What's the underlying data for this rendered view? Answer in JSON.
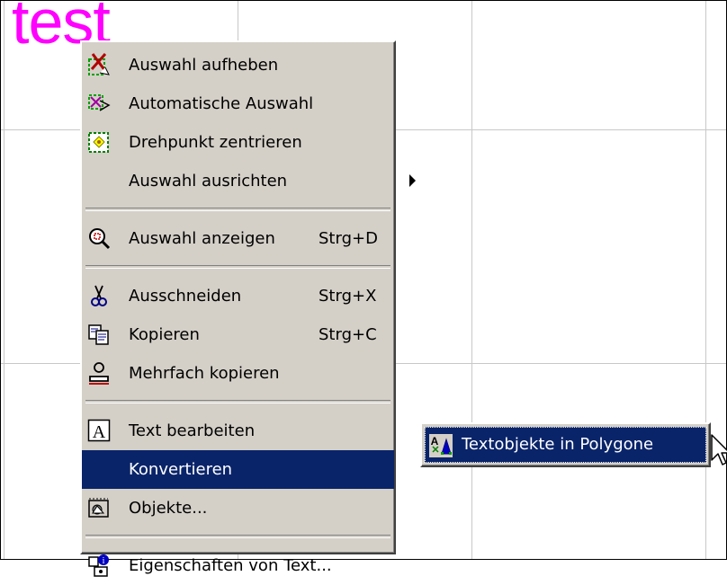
{
  "canvas": {
    "text": "test",
    "text_color": "#ff00ff"
  },
  "menu": {
    "items": [
      {
        "label": "Auswahl aufheben",
        "icon": "deselect-icon"
      },
      {
        "label": "Automatische Auswahl",
        "icon": "auto-select-icon"
      },
      {
        "label": "Drehpunkt zentrieren",
        "icon": "center-pivot-icon"
      },
      {
        "label": "Auswahl ausrichten",
        "icon": "",
        "submenu": true
      },
      {
        "label": "Auswahl anzeigen",
        "shortcut": "Strg+D",
        "icon": "zoom-selection-icon"
      },
      {
        "label": "Ausschneiden",
        "shortcut": "Strg+X",
        "icon": "scissors-icon"
      },
      {
        "label": "Kopieren",
        "shortcut": "Strg+C",
        "icon": "copy-icon"
      },
      {
        "label": "Mehrfach kopieren",
        "icon": "multi-copy-icon"
      },
      {
        "label": "Text bearbeiten",
        "icon": "text-edit-icon"
      },
      {
        "label": "Konvertieren",
        "icon": "",
        "submenu": true,
        "highlighted": true
      },
      {
        "label": "Objekte...",
        "icon": "objects-icon"
      },
      {
        "label": "Eigenschaften von Text...",
        "icon": "properties-icon"
      }
    ]
  },
  "submenu": {
    "items": [
      {
        "label": "Textobjekte in Polygone",
        "icon": "text-to-polygon-icon",
        "highlighted": true
      }
    ]
  },
  "colors": {
    "menu_bg": "#d4d0c8",
    "highlight": "#0a246a",
    "grid": "#c8c8c8"
  }
}
